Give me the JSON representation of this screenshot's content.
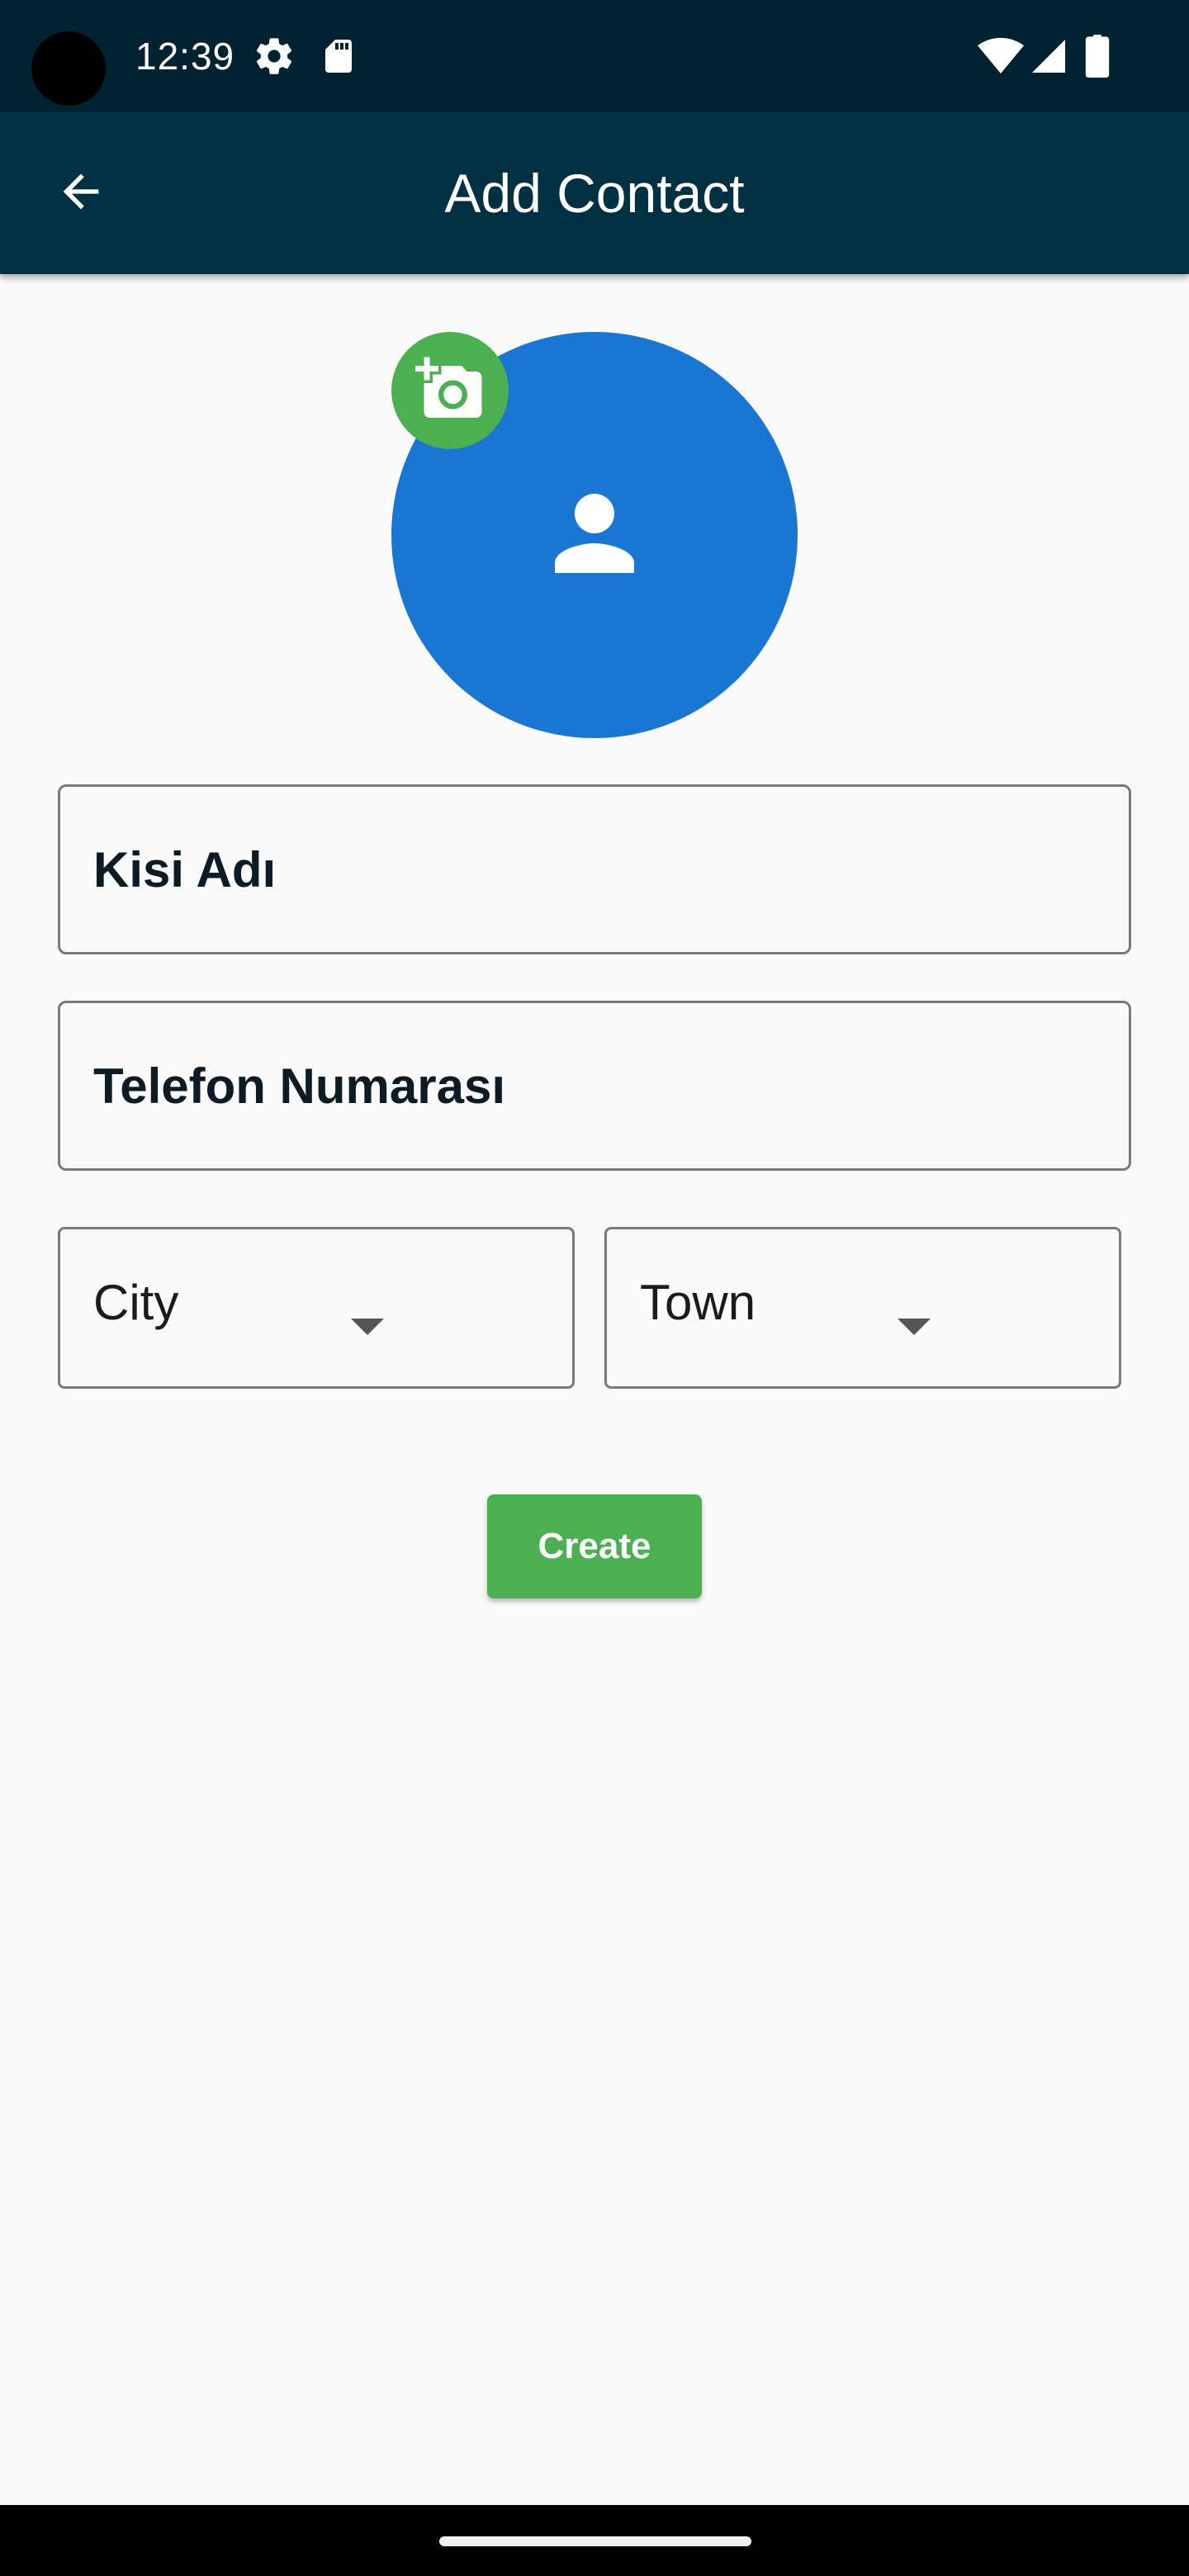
{
  "status_bar": {
    "time": "12:39",
    "icons": [
      "settings-gear-icon",
      "sd-card-icon",
      "wifi-icon",
      "cell-signal-icon",
      "battery-icon"
    ]
  },
  "app_bar": {
    "title": "Add Contact",
    "back_icon": "arrow-left-icon"
  },
  "avatar": {
    "icon": "person-icon",
    "add_photo_icon": "add-a-photo-icon"
  },
  "form": {
    "name_placeholder": "Kisi Adı",
    "name_value": "",
    "phone_placeholder": "Telefon Numarası",
    "phone_value": "",
    "city_label": "City",
    "town_label": "Town",
    "create_label": "Create"
  },
  "colors": {
    "status_bar": "#002231",
    "app_bar": "#003143",
    "avatar": "#1976d2",
    "accent_green": "#4caf50",
    "background": "#fafafa"
  }
}
